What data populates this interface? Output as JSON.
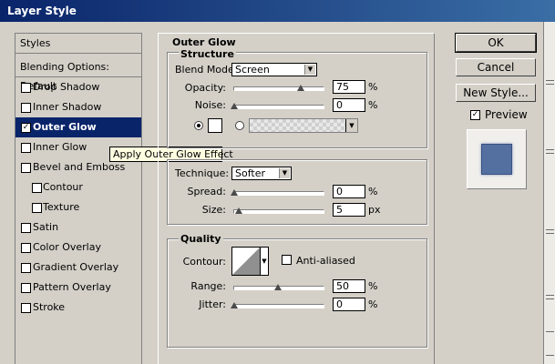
{
  "window": {
    "title": "Layer Style"
  },
  "styles_list": {
    "header": "Styles",
    "blending": "Blending Options: Default",
    "items": [
      {
        "label": "Drop Shadow",
        "checked": false,
        "indent": false
      },
      {
        "label": "Inner Shadow",
        "checked": false,
        "indent": false
      },
      {
        "label": "Outer Glow",
        "checked": true,
        "indent": false,
        "selected": true
      },
      {
        "label": "Inner Glow",
        "checked": false,
        "indent": false
      },
      {
        "label": "Bevel and Emboss",
        "checked": false,
        "indent": false
      },
      {
        "label": "Contour",
        "checked": false,
        "indent": true
      },
      {
        "label": "Texture",
        "checked": false,
        "indent": true
      },
      {
        "label": "Satin",
        "checked": false,
        "indent": false
      },
      {
        "label": "Color Overlay",
        "checked": false,
        "indent": false
      },
      {
        "label": "Gradient Overlay",
        "checked": false,
        "indent": false
      },
      {
        "label": "Pattern Overlay",
        "checked": false,
        "indent": false
      },
      {
        "label": "Stroke",
        "checked": false,
        "indent": false
      }
    ]
  },
  "tooltip": "Apply Outer Glow Effect",
  "outer_glow": {
    "title": "Outer Glow",
    "structure": {
      "title": "Structure",
      "blend_mode_label": "Blend Mode:",
      "blend_mode_value": "Screen",
      "opacity_label": "Opacity:",
      "opacity_value": "75",
      "opacity_unit": "%",
      "noise_label": "Noise:",
      "noise_value": "0",
      "noise_unit": "%"
    },
    "elements": {
      "technique_label": "Technique:",
      "technique_value": "Softer",
      "spread_label": "Spread:",
      "spread_value": "0",
      "spread_unit": "%",
      "size_label": "Size:",
      "size_value": "5",
      "size_unit": "px"
    },
    "quality": {
      "title": "Quality",
      "contour_label": "Contour:",
      "anti_aliased_label": "Anti-aliased",
      "anti_aliased_checked": false,
      "range_label": "Range:",
      "range_value": "50",
      "range_unit": "%",
      "jitter_label": "Jitter:",
      "jitter_value": "0",
      "jitter_unit": "%"
    }
  },
  "buttons": {
    "ok": "OK",
    "cancel": "Cancel",
    "new_style": "New Style..."
  },
  "preview": {
    "label": "Preview",
    "checked": true
  }
}
